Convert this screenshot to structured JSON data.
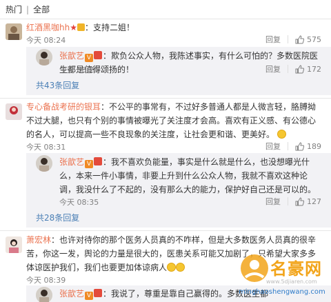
{
  "tabs": [
    "热门",
    "|",
    "全部"
  ],
  "reply_label": "回复",
  "comments": [
    {
      "user": "红酒黑咖hh",
      "text": "：支持二姐！",
      "time": "今天 08:24",
      "likes": "575",
      "reply": {
        "user": "张歆艺",
        "text": "：欺负公众人物，我陈述事实，有什么可怕的？多数医院医生都是值得颂扬的！",
        "time": "今天 08:25",
        "likes": "172"
      },
      "more": "共43条回复"
    },
    {
      "user": "专心备战考研的银耳",
      "text": "：不公平的事常有，不过好多普通人都是人微言轻，胳膊拗不过大腿，也只有个别的事情被曝光了关注度才会高。喜欢有正义感、有公德心的名人，可以提高一些不良现象的关注度，让社会更和谐、更美好。",
      "time": "今天 08:31",
      "likes": "189",
      "reply": {
        "user": "张歆艺",
        "text": "：我不喜欢负能量，事实是什么就是什么，也没想曝光什么，本来一件小事情，非要上升到什么公众人物，我就不喜欢这种论调，我没什么了不起的，没有那么大的能力，保护好自己还是可以的。",
        "time": "今天 08:35",
        "likes": "127"
      },
      "more": "共28条回复"
    },
    {
      "user": "萧宏林",
      "text": "：也许对待你的那个医务人员真的不咋样，但是大多数医务人员真的很辛苦，你这一发，舆论的力量是很大的，医患关系可能又加剧了，只希望大家多多体谅医护我们，我们也要更加体谅病人",
      "time": "今天 08:39",
      "reply": {
        "user": "张歆艺",
        "text": "：我说了，尊重是靠自己赢得的。多数医生都"
      }
    }
  ],
  "watermark": {
    "name": "名豪网",
    "url": "minghaoshengwang.com",
    "faint_url": "www.5djiaren.com"
  },
  "colors": {
    "username": "#eb7350",
    "link": "#4a7fb5",
    "reply_bg": "#f2f2f5",
    "meta": "#808080"
  }
}
